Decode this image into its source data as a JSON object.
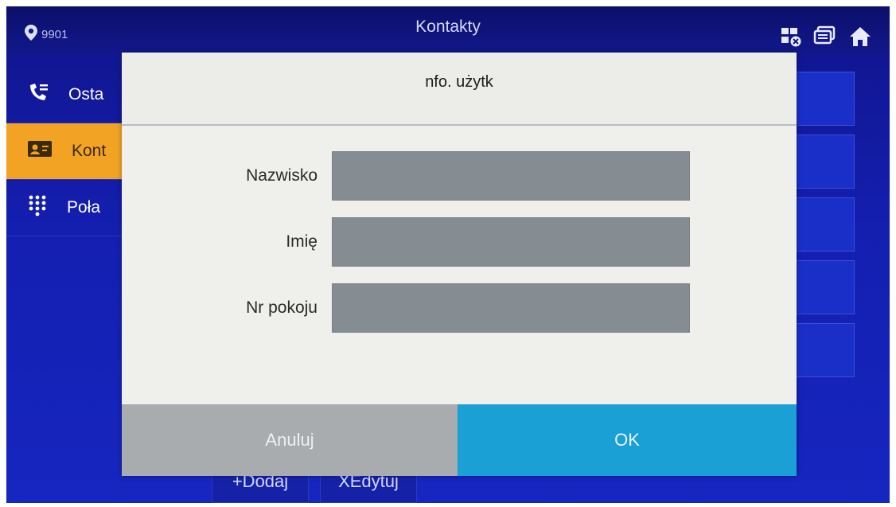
{
  "topbar": {
    "location": "9901",
    "title": "Kontakty",
    "icons": [
      "location-pin-icon",
      "network-status-icon",
      "monitor-icon",
      "home-icon"
    ]
  },
  "sidebar": {
    "items": [
      {
        "label": "Osta",
        "icon": "phone-list-icon",
        "active": false
      },
      {
        "label": "Kont",
        "icon": "contact-card-icon",
        "active": true
      },
      {
        "label": "Poła",
        "icon": "dialpad-icon",
        "active": false
      }
    ]
  },
  "bottom": {
    "add_label": "+Dodaj",
    "edit_label": "XEdytuj"
  },
  "dialog": {
    "title": "nfo. użytk",
    "fields": {
      "surname_label": "Nazwisko",
      "surname_value": "",
      "name_label": "Imię",
      "name_value": "",
      "room_label": "Nr pokoju",
      "room_value": ""
    },
    "cancel_label": "Anuluj",
    "ok_label": "OK"
  },
  "colors": {
    "background": "#141fb0",
    "active_tab": "#f2a323",
    "ok_button": "#1aa0d4",
    "cancel_button": "#a8acaf"
  }
}
